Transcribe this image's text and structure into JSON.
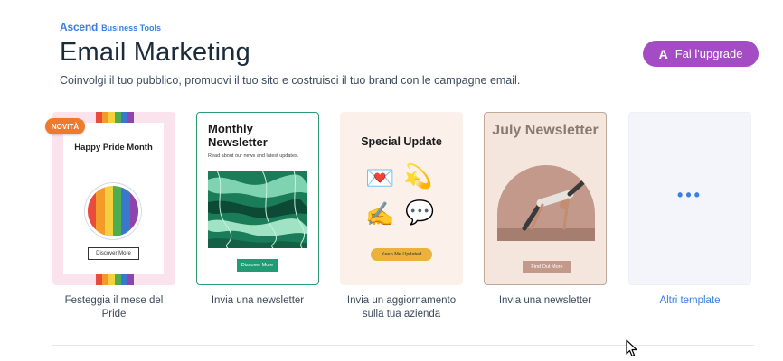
{
  "brand": {
    "name": "Ascend",
    "sub": "Business Tools"
  },
  "page": {
    "title": "Email Marketing",
    "subtitle": "Coinvolgi il tuo pubblico, promuovi il tuo sito e costruisci il tuo brand con le campagne email."
  },
  "upgrade": {
    "label": "Fai l'upgrade",
    "icon": "ascend-logo-icon"
  },
  "templates": [
    {
      "badge": "NOVITÀ",
      "preview_title": "Happy Pride Month",
      "preview_cta": "Discover More",
      "caption": "Festeggia il mese del Pride"
    },
    {
      "preview_title": "Monthly Newsletter",
      "preview_sub": "Read about our news and latest updates.",
      "preview_cta": "Discover More",
      "caption": "Invia una newsletter"
    },
    {
      "preview_title": "Special Update",
      "preview_cta": "Keep Me Updated",
      "emojis": [
        "💌",
        "💫",
        "✍️",
        "💬"
      ],
      "caption": "Invia un aggiornamento sulla tua azienda"
    },
    {
      "preview_title": "July Newsletter",
      "preview_cta": "Find Out More",
      "caption": "Invia una newsletter"
    },
    {
      "preview_more": "•••",
      "caption": "Altri template"
    }
  ],
  "colors": {
    "accent": "#3b7de0",
    "upgrade": "#a44cc4",
    "badge": "#f07a2b",
    "newsletter_green": "#1f9c73",
    "rainbow": [
      "#e94b3c",
      "#f39a2b",
      "#f4d03f",
      "#4cae4f",
      "#3a78c9",
      "#8e44ad"
    ]
  }
}
